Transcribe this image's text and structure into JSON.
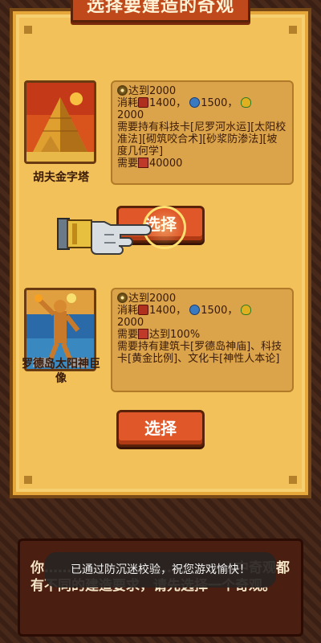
{
  "screen": {
    "title": "选择要建造的奇观"
  },
  "wonders": [
    {
      "name": "胡夫金字塔",
      "req_faith": "达到2000",
      "cost_prefix": "消耗",
      "cost_wood": "1400，",
      "cost_stone": "1500，",
      "cost_food": "2000",
      "req_tech": "需要持有科技卡[尼罗河水运][太阳校准法][砌筑咬合术][砂浆防渗法][坡度几何学]",
      "req_need_prefix": "需要",
      "req_need_value": "40000",
      "select_label": "选择"
    },
    {
      "name": "罗德岛太阳神巨像",
      "req_faith": "达到2000",
      "cost_prefix": "消耗",
      "cost_wood": "1400，",
      "cost_stone": "1500，",
      "cost_food": "2000",
      "req_need_prefix": "需要",
      "req_need_value": "达到100%",
      "req_tech": "需要持有建筑卡[罗德岛神庙]、科技卡[黄金比例]、文化卡[神性人本论]",
      "select_label": "选择"
    }
  ],
  "info": {
    "text": "你……………………………………中奇观都有不同的建造要求，请先选择一个奇观。"
  },
  "toast": {
    "text": "已通过防沉迷校验，祝您游戏愉快！"
  },
  "icons": {
    "faith": "faith-coin-icon",
    "wood": "wood-resource-icon",
    "stone": "stone-resource-icon",
    "food": "corn-resource-icon",
    "box": "red-crate-icon",
    "pointer": "pointing-gauntlet-icon"
  }
}
